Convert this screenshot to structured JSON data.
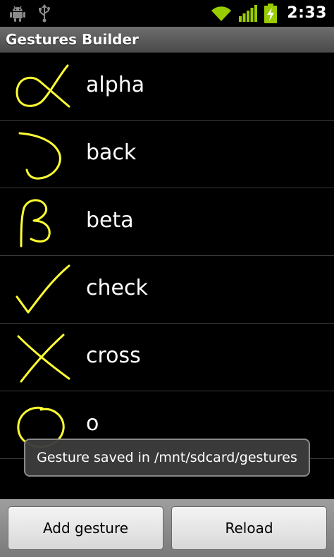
{
  "status_bar": {
    "time": "2:33",
    "left_icons": [
      "android-icon",
      "usb-icon"
    ],
    "right_icons": [
      "wifi-icon",
      "signal-icon",
      "battery-charging-icon"
    ],
    "accent_color": "#99cc00"
  },
  "app": {
    "title": "Gestures Builder"
  },
  "gestures": [
    {
      "name": "alpha"
    },
    {
      "name": "back"
    },
    {
      "name": "beta"
    },
    {
      "name": "check"
    },
    {
      "name": "cross"
    },
    {
      "name": "o"
    }
  ],
  "gesture_stroke_color": "#ffff33",
  "toast": {
    "message": "Gesture saved in /mnt/sdcard/gestures"
  },
  "buttons": {
    "add_label": "Add gesture",
    "reload_label": "Reload"
  }
}
